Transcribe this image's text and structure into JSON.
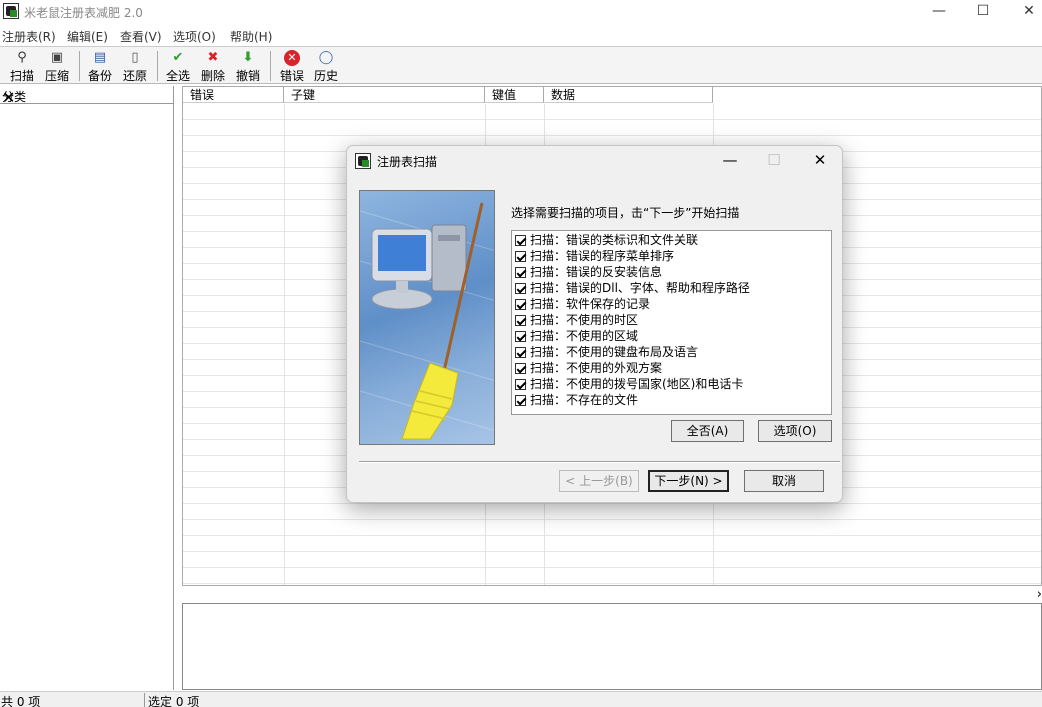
{
  "window": {
    "title": "米老鼠注册表减肥 2.0",
    "minimize": "—",
    "maximize": "☐",
    "close": "✕"
  },
  "menu": [
    "注册表(R)",
    "编辑(E)",
    "查看(V)",
    "选项(O)",
    "帮助(H)"
  ],
  "toolbar": {
    "scan": "扫描",
    "compress": "压缩",
    "backup": "备份",
    "restore": "还原",
    "select_all": "全选",
    "delete": "删除",
    "undo": "撤销",
    "errors": "错误",
    "history": "历史"
  },
  "left_pane": {
    "header": "分类",
    "close": "✕"
  },
  "list": {
    "columns": [
      "错误",
      "子键",
      "键值",
      "数据"
    ]
  },
  "splitter_arrow": "›",
  "status": {
    "total": "共 0 项",
    "selected": "选定 0 项"
  },
  "dialog": {
    "title": "注册表扫描",
    "minimize": "—",
    "maximize": "☐",
    "close": "✕",
    "instruction": "选择需要扫描的项目，击“下一步”开始扫描",
    "items": [
      "扫描：错误的类标识和文件关联",
      "扫描：错误的程序菜单排序",
      "扫描：错误的反安装信息",
      "扫描：错误的Dll、字体、帮助和程序路径",
      "扫描：软件保存的记录",
      "扫描：不使用的时区",
      "扫描：不使用的区域",
      "扫描：不使用的键盘布局及语言",
      "扫描：不使用的外观方案",
      "扫描：不使用的拨号国家(地区)和电话卡",
      "扫描：不存在的文件"
    ],
    "select_none": "全否(A)",
    "options": "选项(O)",
    "back": "< 上一步(B)",
    "next": "下一步(N) >",
    "cancel": "取消"
  },
  "colors": {
    "toolbar_bg": "#f4f4f4",
    "dialog_bg": "#f0f0f0",
    "error_red": "#d8232a",
    "check_green": "#2f9e2f",
    "image_blue": "#6f9ad0"
  },
  "icons": {
    "scan": "magnifier-icon",
    "compress": "compress-icon",
    "backup": "backup-icon",
    "restore": "restore-icon",
    "select_all": "checkmark-icon",
    "delete": "red-x-icon",
    "undo": "green-arrow-icon",
    "errors": "error-icon",
    "history": "history-icon"
  }
}
